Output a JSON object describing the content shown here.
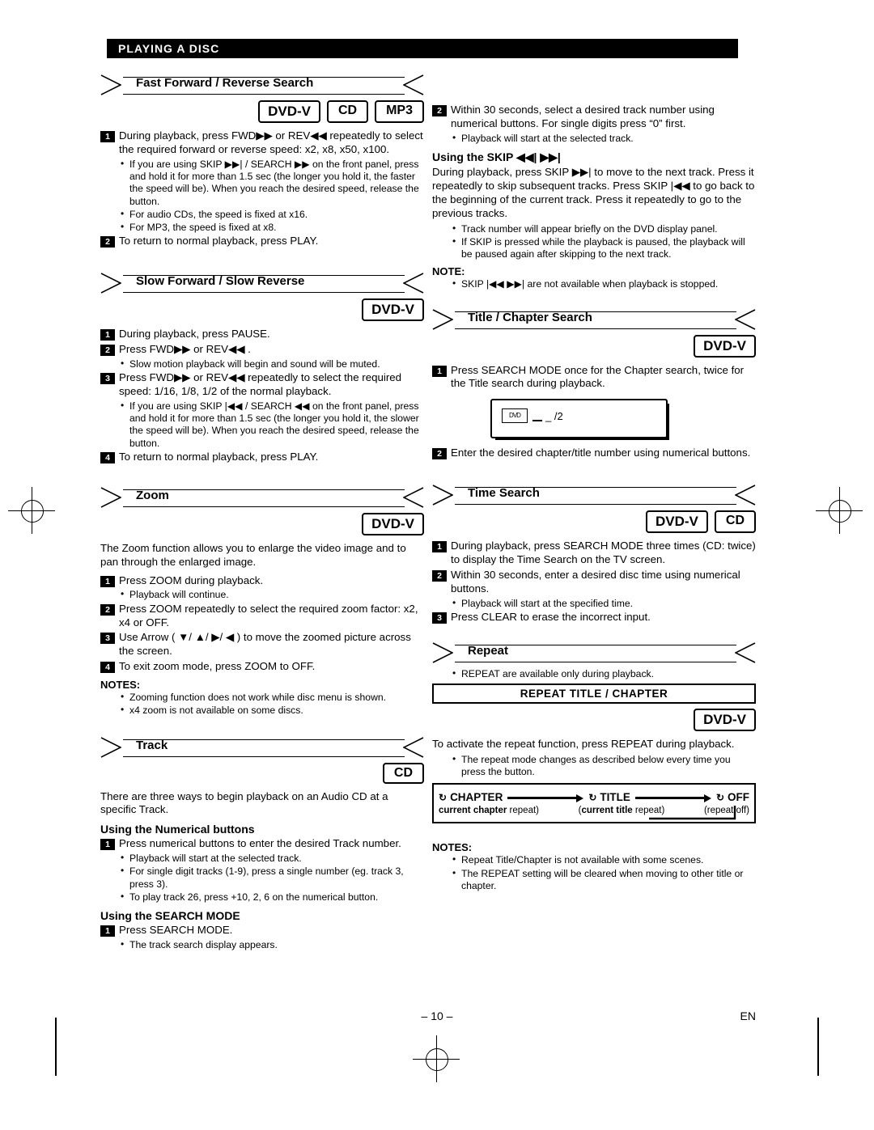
{
  "header": {
    "title": "PLAYING A DISC"
  },
  "badges": {
    "dvdv": "DVD-V",
    "cd": "CD",
    "mp3": "MP3"
  },
  "sections": {
    "ffrs": {
      "title": "Fast Forward / Reverse Search",
      "s1": "During playback, press FWD▶▶ or REV◀◀ repeatedly to select the required forward or reverse speed: x2, x8, x50, x100.",
      "b1": "If you are using SKIP ▶▶| / SEARCH ▶▶ on the front panel, press and hold it for more than 1.5 sec (the longer you hold it, the faster the speed will be). When you reach the desired speed, release the button.",
      "b2": "For audio CDs, the speed is fixed at x16.",
      "b3": "For MP3, the speed is fixed at x8.",
      "s2": "To return to normal playback, press PLAY."
    },
    "slow": {
      "title": "Slow Forward / Slow Reverse",
      "badge": "DVD-V",
      "s1": "During playback, press PAUSE.",
      "s2": "Press FWD▶▶ or REV◀◀ .",
      "b1": "Slow motion playback will begin and sound will be muted.",
      "s3": "Press FWD▶▶ or REV◀◀ repeatedly to select the required speed: 1/16, 1/8, 1/2 of the normal playback.",
      "b2": "If you are using SKIP |◀◀ / SEARCH ◀◀ on the front panel, press and hold it for more than 1.5 sec (the longer you hold it, the slower the speed will be). When you reach the desired speed, release the button.",
      "s4": "To return to normal playback, press PLAY."
    },
    "zoom": {
      "title": "Zoom",
      "badge": "DVD-V",
      "intro": "The Zoom function allows you to enlarge the video image and to pan through the enlarged image.",
      "s1": "Press ZOOM during playback.",
      "b1": "Playback will continue.",
      "s2": "Press ZOOM repeatedly to select the required zoom factor: x2, x4 or OFF.",
      "s3": "Use Arrow ( ▼/ ▲/ ▶/ ◀ ) to move the zoomed picture across the screen.",
      "s4": "To exit zoom mode, press ZOOM to OFF.",
      "notes_label": "NOTES:",
      "n1": "Zooming function does not work while disc menu is shown.",
      "n2": "x4 zoom is not available on some discs."
    },
    "track": {
      "title": "Track",
      "badge": "CD",
      "intro": "There are three ways to begin playback on an Audio CD at a specific Track.",
      "sub1": "Using the Numerical buttons",
      "s1": "Press numerical buttons to enter the desired Track number.",
      "b1": "Playback will start at the selected track.",
      "b2": "For single digit tracks (1-9), press a single number (eg. track 3, press 3).",
      "b3": "To play track 26, press +10, 2, 6 on the numerical button.",
      "sub2": "Using the SEARCH MODE",
      "s2": "Press SEARCH MODE.",
      "b4": "The track search display appears."
    },
    "track_right": {
      "s2": "Within 30 seconds, select a desired track number using numerical buttons.  For single digits press “0” first.",
      "b1": "Playback will start at the selected track.",
      "sub": "Using the SKIP ◀◀| ▶▶|",
      "p1": "During playback, press SKIP ▶▶| to move to the next track. Press it repeatedly to skip subsequent tracks.  Press SKIP |◀◀ to go back to the beginning of the current track.  Press it repeatedly to go to the previous tracks.",
      "b2": "Track number will appear briefly on the DVD display panel.",
      "b3": "If SKIP is pressed while the playback is paused, the playback will be paused again after skipping to the next track.",
      "note_label": "NOTE:",
      "n1": "SKIP |◀◀ ▶▶| are not available when playback is stopped."
    },
    "title_chapter": {
      "title": "Title / Chapter Search",
      "badge": "DVD-V",
      "s1": "Press SEARCH MODE once for the Chapter search, twice for the Title search during playback.",
      "panel_icon": "DVD",
      "panel_text": "_ /2",
      "s2": "Enter the desired chapter/title number using numerical buttons."
    },
    "time_search": {
      "title": "Time Search",
      "badge1": "DVD-V",
      "badge2": "CD",
      "s1": "During playback, press SEARCH MODE three times (CD: twice) to display the Time Search on the TV screen.",
      "s2": "Within 30 seconds, enter a desired disc time using numerical buttons.",
      "b1": "Playback will start at the specified time.",
      "s3": "Press CLEAR to erase the incorrect input."
    },
    "repeat": {
      "title": "Repeat",
      "b1": "REPEAT are available only during playback.",
      "box_label": "REPEAT TITLE / CHAPTER",
      "badge": "DVD-V",
      "p1": "To activate the repeat function, press REPEAT during playback.",
      "b2": "The repeat mode changes as described below every time you press the button.",
      "flow": {
        "item1": "CHAPTER",
        "item2": "TITLE",
        "item3": "OFF",
        "sub1": "(current chapter repeat)",
        "sub2": "(current title repeat)",
        "sub3": "(repeat off)"
      },
      "notes_label": "NOTES:",
      "n1": "Repeat Title/Chapter is not available with some scenes.",
      "n2": "The REPEAT setting will be cleared when moving to other title or chapter."
    }
  },
  "footer": {
    "page": "– 10 –",
    "lang": "EN"
  }
}
